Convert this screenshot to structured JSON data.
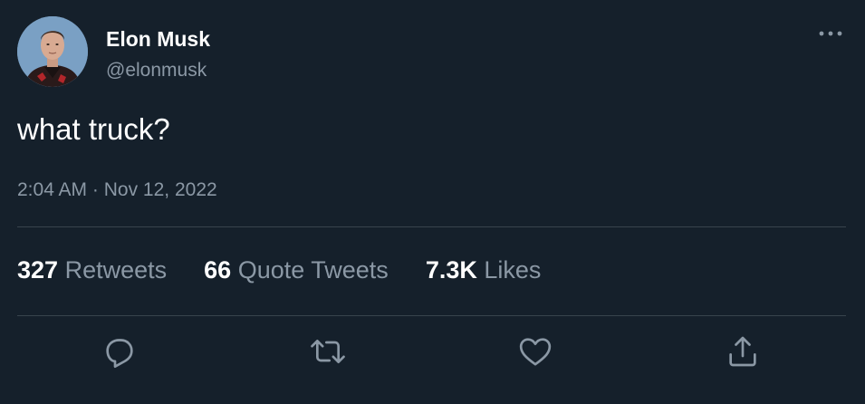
{
  "tweet": {
    "author": {
      "name": "Elon Musk",
      "handle": "@elonmusk"
    },
    "text": "what truck?",
    "time": "2:04 AM",
    "separator": "·",
    "date": "Nov 12, 2022",
    "stats": [
      {
        "value": "327",
        "label": "Retweets"
      },
      {
        "value": "66",
        "label": "Quote Tweets"
      },
      {
        "value": "7.3K",
        "label": "Likes"
      }
    ],
    "actions": {
      "icons": [
        "reply-icon",
        "retweet-icon",
        "like-icon",
        "share-icon"
      ]
    },
    "menu_icon": "more-options-icon"
  },
  "colors": {
    "background": "#15202b",
    "primary_text": "#ffffff",
    "secondary_text": "#8b98a5",
    "divider": "#38444d"
  }
}
